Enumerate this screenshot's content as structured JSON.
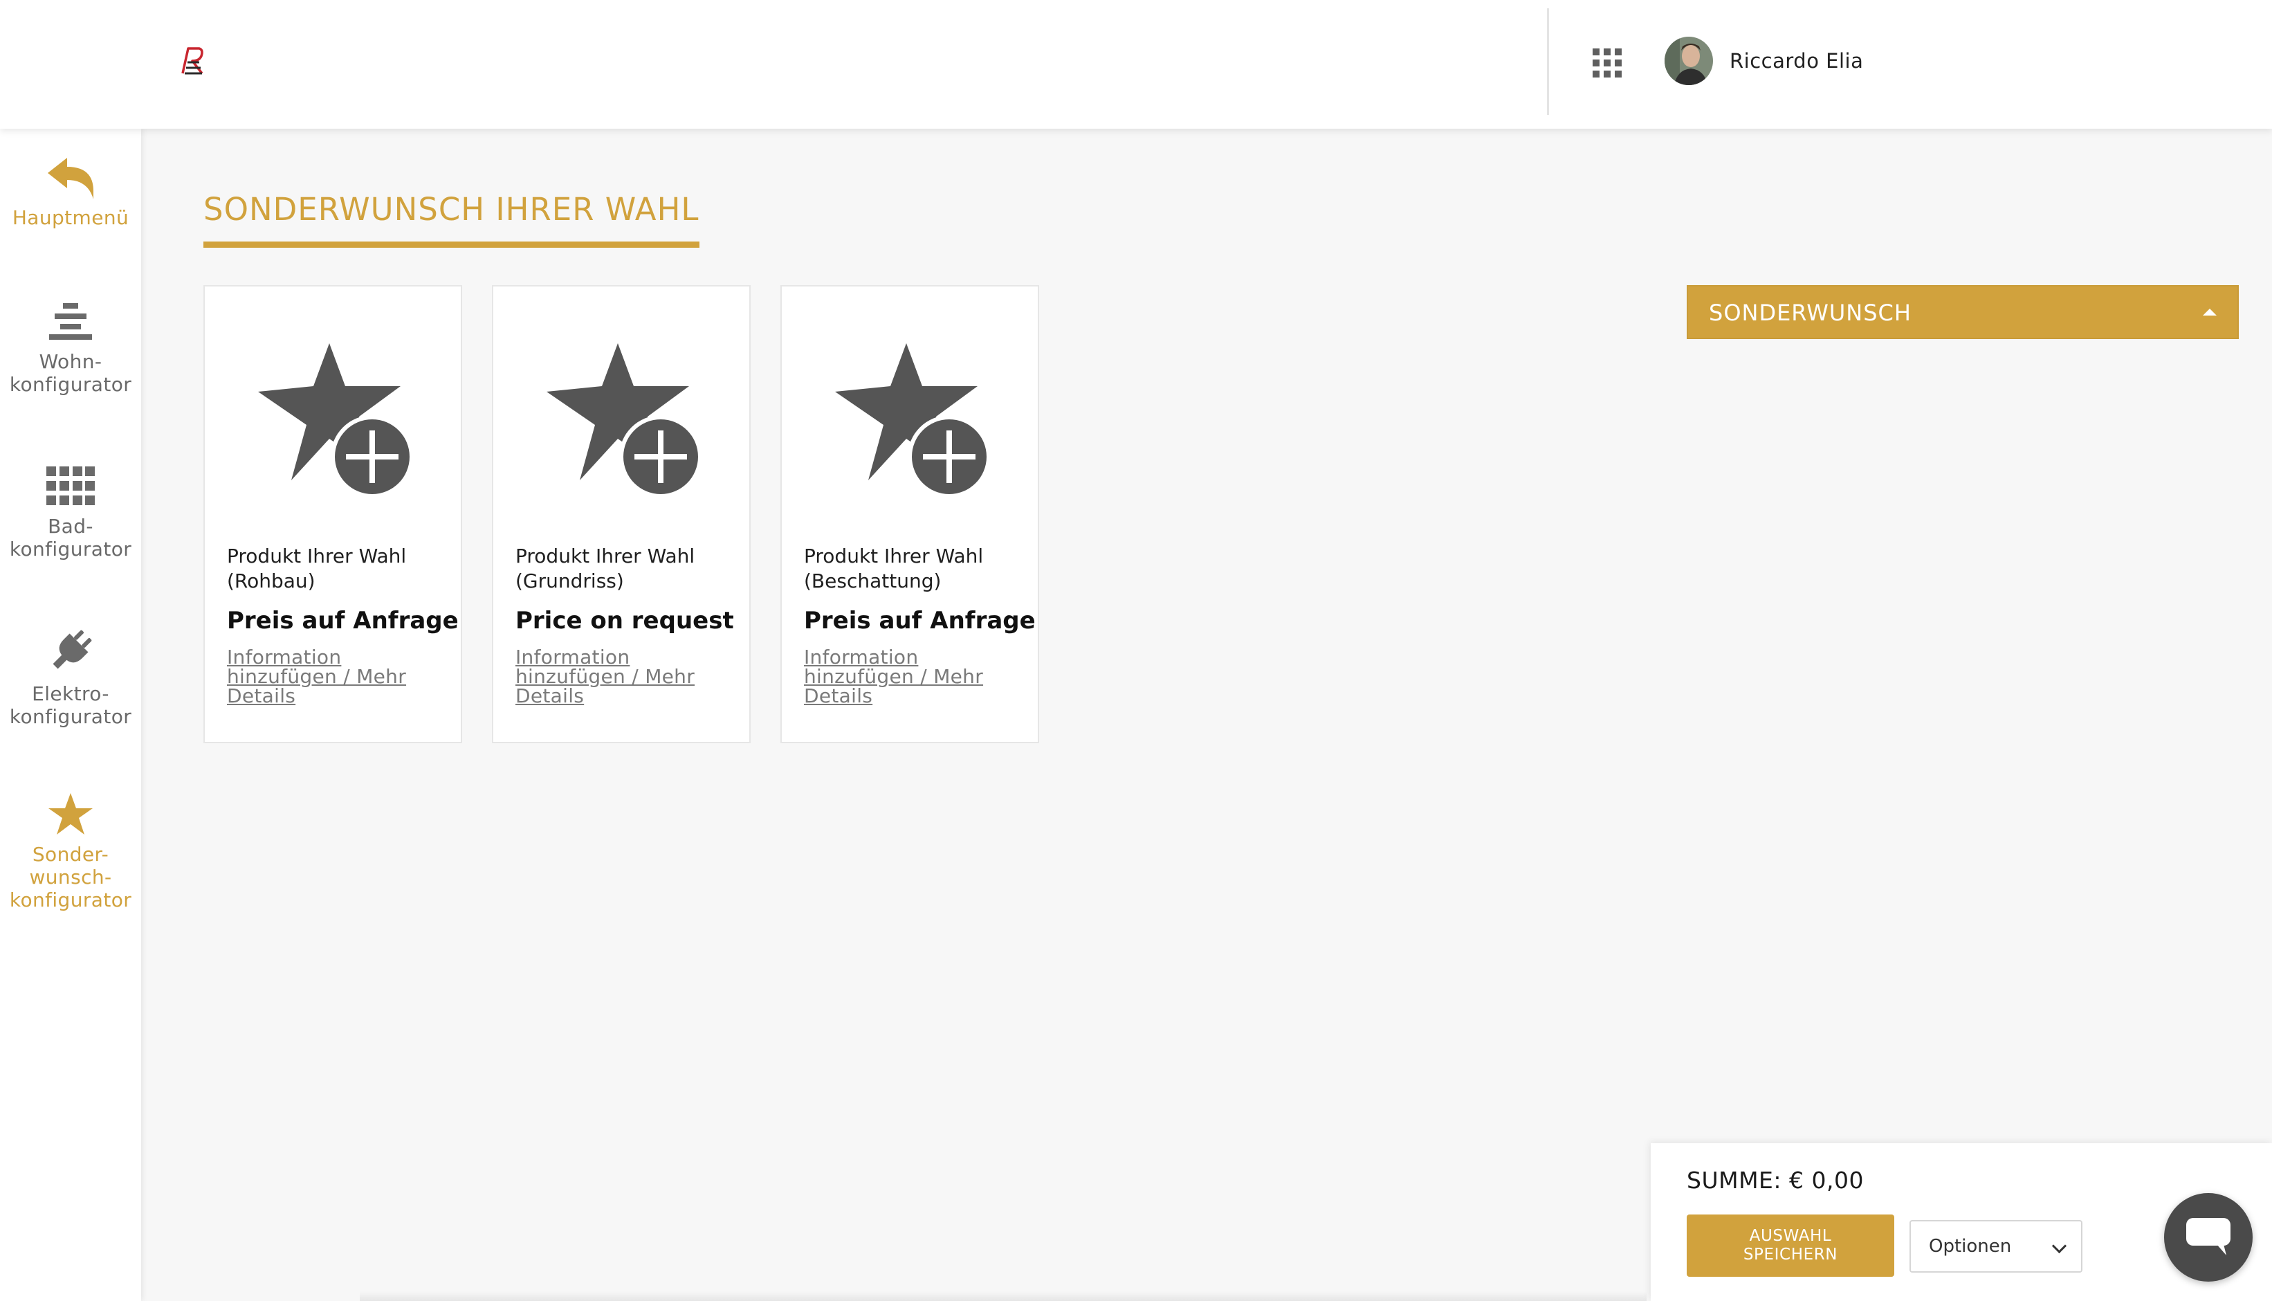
{
  "header": {
    "logo": "R-logo-icon",
    "apps_icon": "grid-icon",
    "user_name": "Riccardo Elia"
  },
  "sidebar": {
    "items": [
      {
        "label": "Hauptmenü",
        "icon": "back-arrow-icon",
        "active": true
      },
      {
        "label_lines": [
          "Wohn-",
          "konfigurator"
        ],
        "icon": "layers-icon"
      },
      {
        "label_lines": [
          "Bad-",
          "konfigurator"
        ],
        "icon": "grid-icon"
      },
      {
        "label_lines": [
          "Elektro-",
          "konfigurator"
        ],
        "icon": "plug-icon"
      },
      {
        "label_lines": [
          "Sonder-",
          "wunsch-",
          "konfigurator"
        ],
        "icon": "star-icon",
        "active": true
      }
    ]
  },
  "main": {
    "title": "SONDERWUNSCH IHRER WAHL",
    "cards": [
      {
        "name_lines": [
          "Produkt Ihrer Wahl",
          "(Rohbau)"
        ],
        "price": "Preis auf Anfrage",
        "info_lines": [
          "Information",
          "hinzufügen / Mehr",
          "Details"
        ]
      },
      {
        "name_lines": [
          "Produkt Ihrer Wahl",
          "(Grundriss)"
        ],
        "price": "Price on request",
        "info_lines": [
          "Information",
          "hinzufügen / Mehr",
          "Details"
        ]
      },
      {
        "name_lines": [
          "Produkt Ihrer Wahl",
          "(Beschattung)"
        ],
        "price": "Preis auf Anfrage",
        "info_lines": [
          "Information",
          "hinzufügen / Mehr",
          "Details"
        ]
      }
    ],
    "accordion": {
      "label": "SONDERWUNSCH",
      "state": "expanded"
    }
  },
  "summary": {
    "total": "SUMME: € 0,00",
    "save_lines": [
      "AUSWAHL",
      "SPEICHERN"
    ],
    "options_value": "Optionen"
  },
  "colors": {
    "accent": "#d1a23d",
    "background": "#f7f7f7",
    "icon_dark": "#555555",
    "sidebar_icon": "#6a6a6a"
  }
}
